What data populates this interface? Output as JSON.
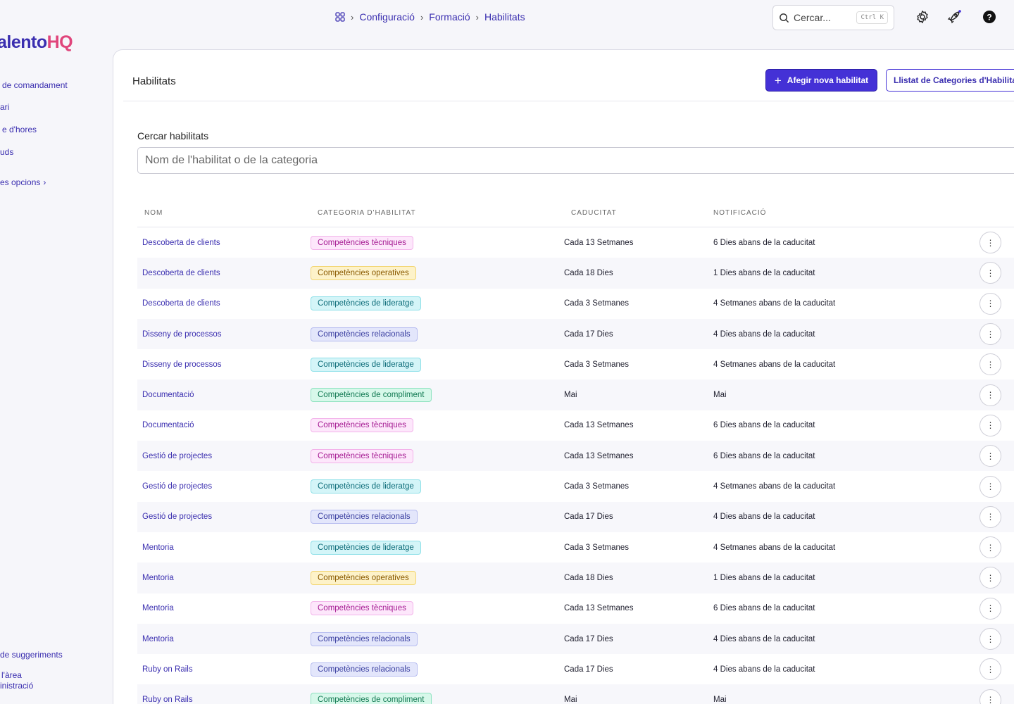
{
  "breadcrumb": {
    "items": [
      "Configuració",
      "Formació",
      "Habilitats"
    ]
  },
  "top": {
    "search_placeholder": "Cercar...",
    "shortcut": "Ctrl K"
  },
  "brand": {
    "part1": "alento",
    "part2": "HQ"
  },
  "sidebar": {
    "items": [
      "de comandament",
      "ari",
      "e d'hores",
      "uds",
      "es opcions"
    ],
    "footer": [
      "de suggeriments",
      "l'àrea",
      "inistració"
    ]
  },
  "page": {
    "title": "Habilitats",
    "add_button": "Afegir nova habilitat",
    "categories_button": "Llistat de Categories d'Habilitats",
    "search_label": "Cercar habilitats",
    "search_placeholder": "Nom de l'habilitat o de la categoria"
  },
  "table": {
    "headers": [
      "NOM",
      "CATEGORIA D'HABILITAT",
      "CADUCITAT",
      "NOTIFICACIÓ"
    ],
    "category_styles": {
      "Competències tècniques": {
        "bg": "#fde7fb",
        "border": "#f3b3ea",
        "fg": "#a61c93"
      },
      "Competències operatives": {
        "bg": "#fdf2c9",
        "border": "#f2d674",
        "fg": "#8a5a00"
      },
      "Competències de lideratge": {
        "bg": "#d4f5f8",
        "border": "#8ee0e8",
        "fg": "#0c6b78"
      },
      "Competències relacionals": {
        "bg": "#e3e6fb",
        "border": "#b7bdf0",
        "fg": "#3a3fa0"
      },
      "Competències de compliment": {
        "bg": "#d7f8ea",
        "border": "#8fe2c0",
        "fg": "#137a53"
      }
    },
    "rows": [
      {
        "name": "Descoberta de clients",
        "category": "Competències tècniques",
        "expiry": "Cada 13 Setmanes",
        "notification": "6 Dies abans de la caducitat"
      },
      {
        "name": "Descoberta de clients",
        "category": "Competències operatives",
        "expiry": "Cada 18 Dies",
        "notification": "1 Dies abans de la caducitat"
      },
      {
        "name": "Descoberta de clients",
        "category": "Competències de lideratge",
        "expiry": "Cada 3 Setmanes",
        "notification": "4 Setmanes abans de la caducitat"
      },
      {
        "name": "Disseny de processos",
        "category": "Competències relacionals",
        "expiry": "Cada 17 Dies",
        "notification": "4 Dies abans de la caducitat"
      },
      {
        "name": "Disseny de processos",
        "category": "Competències de lideratge",
        "expiry": "Cada 3 Setmanes",
        "notification": "4 Setmanes abans de la caducitat"
      },
      {
        "name": "Documentació",
        "category": "Competències de compliment",
        "expiry": "Mai",
        "notification": "Mai"
      },
      {
        "name": "Documentació",
        "category": "Competències tècniques",
        "expiry": "Cada 13 Setmanes",
        "notification": "6 Dies abans de la caducitat"
      },
      {
        "name": "Gestió de projectes",
        "category": "Competències tècniques",
        "expiry": "Cada 13 Setmanes",
        "notification": "6 Dies abans de la caducitat"
      },
      {
        "name": "Gestió de projectes",
        "category": "Competències de lideratge",
        "expiry": "Cada 3 Setmanes",
        "notification": "4 Setmanes abans de la caducitat"
      },
      {
        "name": "Gestió de projectes",
        "category": "Competències relacionals",
        "expiry": "Cada 17 Dies",
        "notification": "4 Dies abans de la caducitat"
      },
      {
        "name": "Mentoria",
        "category": "Competències de lideratge",
        "expiry": "Cada 3 Setmanes",
        "notification": "4 Setmanes abans de la caducitat"
      },
      {
        "name": "Mentoria",
        "category": "Competències operatives",
        "expiry": "Cada 18 Dies",
        "notification": "1 Dies abans de la caducitat"
      },
      {
        "name": "Mentoria",
        "category": "Competències tècniques",
        "expiry": "Cada 13 Setmanes",
        "notification": "6 Dies abans de la caducitat"
      },
      {
        "name": "Mentoria",
        "category": "Competències relacionals",
        "expiry": "Cada 17 Dies",
        "notification": "4 Dies abans de la caducitat"
      },
      {
        "name": "Ruby on Rails",
        "category": "Competències relacionals",
        "expiry": "Cada 17 Dies",
        "notification": "4 Dies abans de la caducitat"
      },
      {
        "name": "Ruby on Rails",
        "category": "Competències de compliment",
        "expiry": "Mai",
        "notification": "Mai"
      }
    ]
  },
  "colors": {
    "accent": "#4431d6",
    "link": "#3b2fb0",
    "brand_pink": "#e0457b"
  }
}
